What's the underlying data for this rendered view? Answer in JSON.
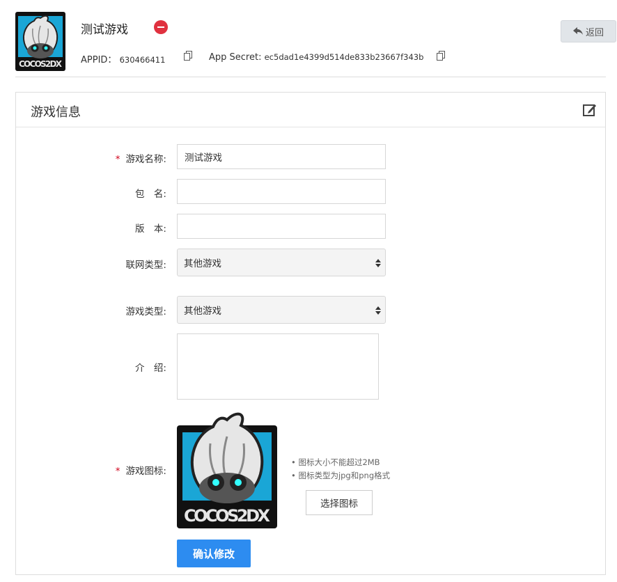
{
  "header": {
    "game_name": "测试游戏",
    "appid_label": "APPID：",
    "appid_value": "630466411",
    "secret_label": "App Secret:",
    "secret_value": "ec5dad1e4399d514de833b23667f343b",
    "back_label": "返回",
    "logo_text": "COCOS2DX"
  },
  "panel": {
    "title": "游戏信息"
  },
  "form": {
    "required_mark": "*",
    "name_label": "游戏名称:",
    "name_value": "测试游戏",
    "package_label": "包　名:",
    "package_value": "",
    "version_label": "版　本:",
    "version_value": "",
    "network_label": "联网类型:",
    "network_value": "其他游戏",
    "category_label": "游戏类型:",
    "category_value": "其他游戏",
    "intro_label": "介　绍:",
    "intro_value": "",
    "icon_label": "游戏图标:",
    "icon_hints": [
      "• 图标大小不能超过2MB",
      "• 图标类型为jpg和png格式"
    ],
    "choose_icon_label": "选择图标",
    "confirm_label": "确认修改"
  },
  "colors": {
    "primary": "#2d8cf0",
    "danger": "#e0313f",
    "required": "#d0021b",
    "logo_cyan": "#1aa6d6"
  },
  "icons": [
    "minus-circle-icon",
    "copy-icon",
    "back-arrow-icon",
    "edit-icon",
    "select-arrows-icon"
  ]
}
